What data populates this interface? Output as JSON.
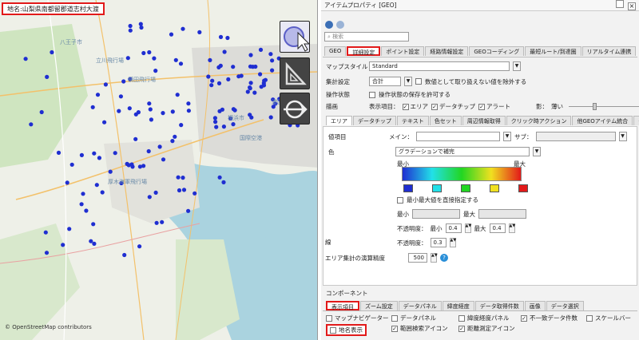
{
  "map": {
    "place_label": "地名:山梨県南都留郡道志村大渡",
    "attribution": "© OpenStreetMap contributors",
    "place_names": [
      "八王子市",
      "立川飛行場",
      "横田飛行場",
      "厚木海軍飛行場",
      "横浜市",
      "国際空港",
      "港区"
    ],
    "tools": [
      "select-tool-icon",
      "measure-tool-icon",
      "route-tool-icon"
    ],
    "colors": {
      "marker": "#1f2ed1",
      "water": "#aad3df",
      "land": "#eef0e8",
      "highlight": "#e21a1a"
    }
  },
  "panel": {
    "title": "アイテムプロパティ [GEO]",
    "search_placeholder": "検索",
    "main_tabs": [
      "GEO",
      "詳細設定",
      "ポイント設定",
      "経路情報設定",
      "GEOコーディング",
      "最短ルート/到達圏",
      "リアルタイム連携"
    ],
    "map_style_label": "マップスタイル",
    "map_style_value": "Standard",
    "aggregate_label": "集計設定",
    "aggregate_value": "合計",
    "exclude_nonnumeric": "数値として取り扱えない値を除外する",
    "operation_label": "操作状態",
    "save_state": "操作状態の保存を許可する",
    "draw_label": "描画",
    "display_items_label": "表示項目：",
    "display_items": [
      {
        "label": "エリア",
        "checked": true
      },
      {
        "label": "データチップ",
        "checked": true
      },
      {
        "label": "アラート",
        "checked": true
      }
    ],
    "shadow_label": "影：",
    "shadow_value": "薄い",
    "sub_tabs": [
      "エリア",
      "データチップ",
      "テキスト",
      "色セット",
      "周辺情報取得",
      "クリック時アクション",
      "他GEOアイテム統合",
      "その他"
    ],
    "value_item_label": "値項目",
    "main_label": "メイン：",
    "sub_label": "サブ：",
    "color_label": "色",
    "gradient_value": "グラデーションで補完",
    "min_label": "最小",
    "max_label": "最大",
    "direct_minmax": "最小最大値を直接指定する",
    "min_field_label": "最小",
    "max_field_label": "最大",
    "opacity_label": "不透明度：",
    "opacity_min_label": "最小",
    "opacity_min": "0.4",
    "opacity_max_label": "最大",
    "opacity_max": "0.4",
    "line_label": "線",
    "line_opacity_label": "不透明度：",
    "line_opacity": "0.3",
    "area_precision_label": "エリア集計の演算精度",
    "area_precision_value": "500",
    "gradient_colors": [
      "#1f2ed1",
      "#22e0e8",
      "#22d622",
      "#f0e020",
      "#e21a1a"
    ],
    "component_label": "コンポーネント",
    "component_tabs": [
      "表示項目",
      "ズーム設定",
      "データパネル",
      "緯度経度",
      "データ取得件数",
      "画像",
      "データ選択"
    ],
    "component_items": [
      {
        "label": "マップナビゲーター",
        "checked": false
      },
      {
        "label": "データパネル",
        "checked": false
      },
      {
        "label": "緯度経度パネル",
        "checked": false
      },
      {
        "label": "不一致データ件数",
        "checked": true
      },
      {
        "label": "スケールバー",
        "checked": false
      },
      {
        "label": "地名表示",
        "checked": false
      },
      {
        "label": "範囲検索アイコン",
        "checked": true
      },
      {
        "label": "距離測定アイコン",
        "checked": true
      }
    ]
  }
}
